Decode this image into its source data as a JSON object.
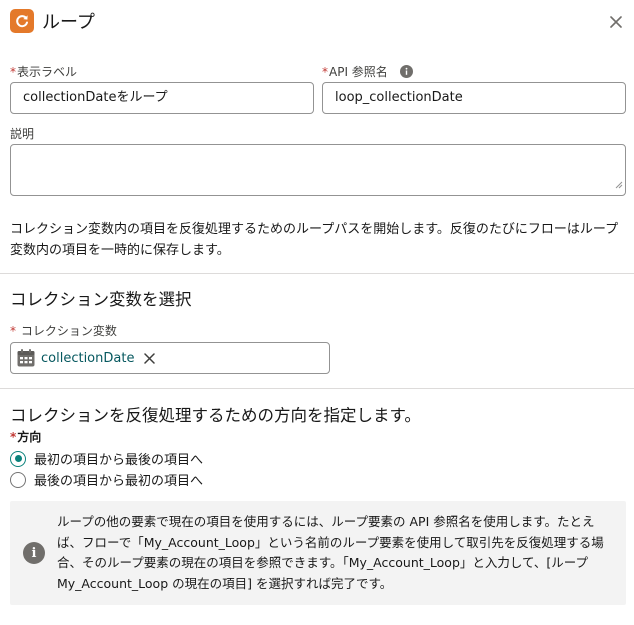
{
  "header": {
    "title": "ループ",
    "icon": "loop-icon",
    "icon_color": "#e4792a",
    "close_icon": "close-icon"
  },
  "fields": {
    "required_mark": "*",
    "display_label": {
      "label": "表示ラベル",
      "value": "collectionDateをループ"
    },
    "api_name": {
      "label": "API 参照名",
      "value": "loop_collectionDate",
      "help_icon": "info-icon"
    },
    "description": {
      "label": "説明",
      "value": ""
    }
  },
  "help_text": "コレクション変数内の項目を反復処理するためのループパスを開始します。反復のたびにフローはループ変数内の項目を一時的に保存します。",
  "collection_section": {
    "title": "コレクション変数を選択",
    "field_label": "コレクション変数",
    "selected_pill": "collectionDate",
    "pill_icon": "calendar-icon",
    "pill_color": "#06585f"
  },
  "direction_section": {
    "title": "コレクションを反復処理するための方向を指定します。",
    "field_label": "方向",
    "options": [
      {
        "label": "最初の項目から最後の項目へ",
        "checked": true
      },
      {
        "label": "最後の項目から最初の項目へ",
        "checked": false
      }
    ],
    "accent_color": "#0b827c"
  },
  "notice": {
    "icon": "info-icon",
    "text": "ループの他の要素で現在の項目を使用するには、ループ要素の API 参照名を使用します。たとえば、フローで「My_Account_Loop」という名前のループ要素を使用して取引先を反復処理する場合、そのループ要素の現在の項目を参照できます。「My_Account_Loop」と入力して、[ループ My_Account_Loop の現在の項目] を選択すれば完了です。"
  }
}
